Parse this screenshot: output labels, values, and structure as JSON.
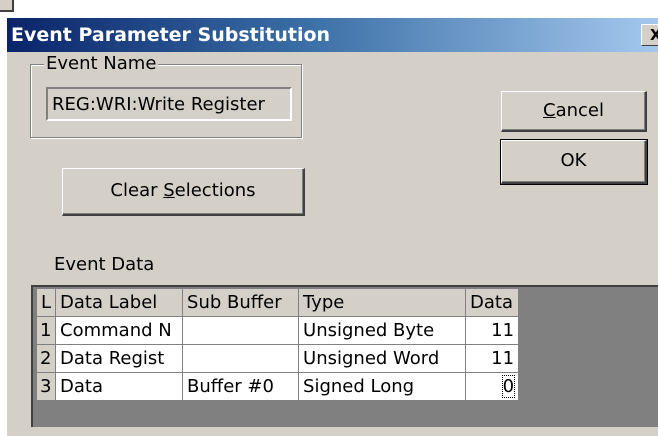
{
  "window": {
    "title": "Event Parameter Substitution",
    "close_label": "X"
  },
  "event_name": {
    "group_label": "Event Name",
    "value": "REG:WRI:Write Register"
  },
  "buttons": {
    "cancel": {
      "accel": "C",
      "rest": "ancel"
    },
    "ok": "OK",
    "clear": {
      "pre": "Clear ",
      "accel": "S",
      "rest": "elections"
    }
  },
  "event_data": {
    "label": "Event Data",
    "columns": [
      "L",
      "Data Label",
      "Sub Buffer",
      "Type",
      "Data"
    ],
    "rows": [
      [
        "1",
        "Command N",
        "",
        "Unsigned Byte",
        "11"
      ],
      [
        "2",
        "Data Regist",
        "",
        "Unsigned Word",
        "11"
      ],
      [
        "3",
        "Data",
        "Buffer #0",
        "Signed Long",
        "0"
      ]
    ]
  }
}
